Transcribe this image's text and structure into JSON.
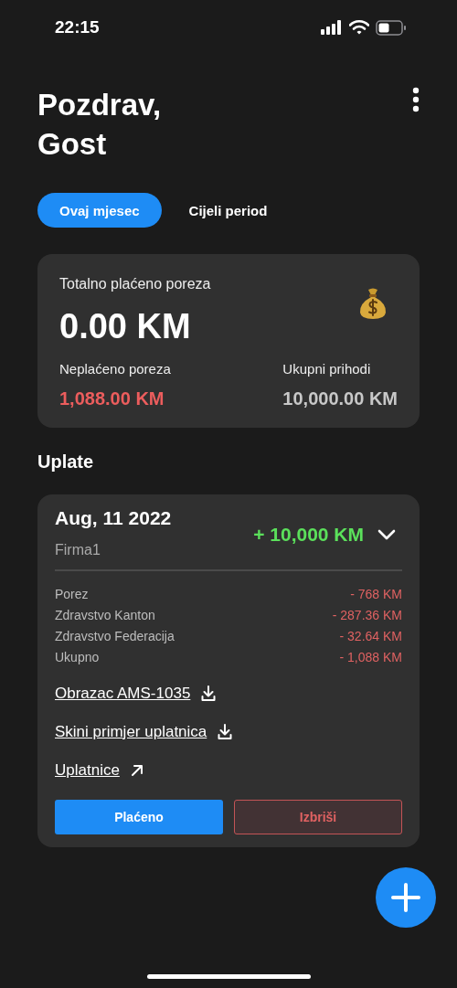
{
  "status_bar": {
    "time": "22:15"
  },
  "greeting": {
    "lines": [
      "Pozdrav,",
      "Gost"
    ]
  },
  "tabs": [
    {
      "label": "Ovaj mjesec",
      "selected": true
    },
    {
      "label": "Cijeli period",
      "selected": false
    }
  ],
  "summary": {
    "title": "Totalno plaćeno poreza",
    "total": "0.00 KM",
    "stats": [
      {
        "label": "Neplaćeno poreza",
        "value": "1,088.00 KM",
        "kind": "negative"
      },
      {
        "label": "Ukupni prihodi",
        "value": "10,000.00 KM",
        "kind": "neutral"
      }
    ]
  },
  "section_title": "Uplate",
  "payments": [
    {
      "date": "Aug, 11 2022",
      "company": "Firma1",
      "amount": "+ 10,000 KM",
      "expanded": true,
      "lines": [
        {
          "label": "Porez",
          "value": "- 768 KM"
        },
        {
          "label": "Zdravstvo Kanton",
          "value": "- 287.36 KM"
        },
        {
          "label": "Zdravstvo Federacija",
          "value": "- 32.64 KM"
        },
        {
          "label": "Ukupno",
          "value": "- 1,088 KM"
        }
      ],
      "links": [
        {
          "label": "Obrazac AMS-1035",
          "kind": "download"
        },
        {
          "label": "Skini primjer uplatnica",
          "kind": "download"
        },
        {
          "label": "Uplatnice",
          "kind": "external"
        }
      ],
      "buttons": [
        {
          "label": "Plaćeno",
          "kind": "primary"
        },
        {
          "label": "Izbriši",
          "kind": "danger"
        }
      ]
    }
  ]
}
